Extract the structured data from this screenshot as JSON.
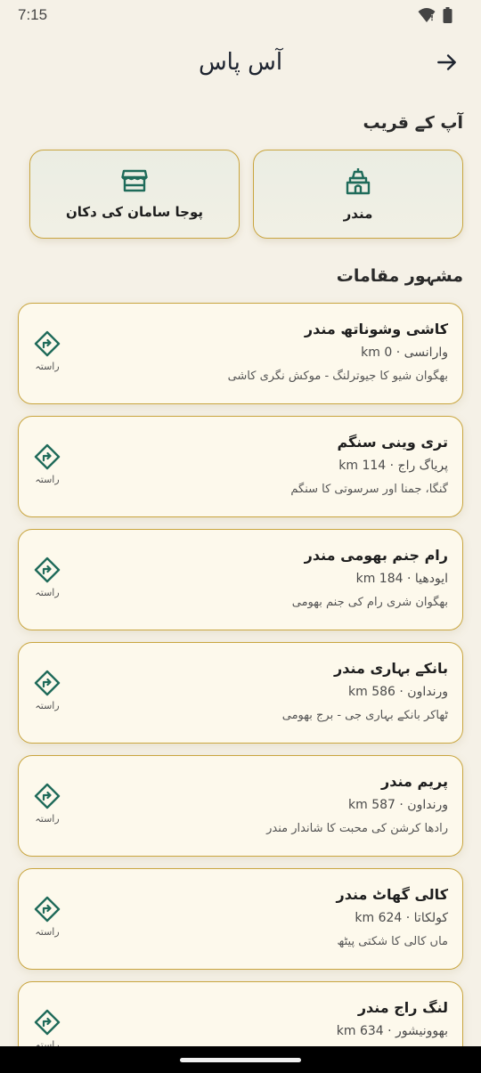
{
  "status_bar": {
    "time": "7:15"
  },
  "app_bar": {
    "title": "آس پاس"
  },
  "nearby": {
    "section_title": "آپ کے قریب",
    "items": [
      {
        "label": "مندر",
        "icon": "temple-icon"
      },
      {
        "label": "پوجا سامان کی دکان",
        "icon": "store-icon"
      }
    ]
  },
  "famous": {
    "section_title": "مشہور مقامات",
    "route_label": "راستہ",
    "places": [
      {
        "name": "کاشی وشوناتھ مندر",
        "meta": "وارانسی · km 0",
        "desc": "بھگوان شیو کا جیوترلنگ - موکش نگری کاشی"
      },
      {
        "name": "تری وینی سنگم",
        "meta": "پریاگ راج · km 114",
        "desc": "گنگا، جمنا اور سرسوتی کا سنگم"
      },
      {
        "name": "رام جنم بھومی مندر",
        "meta": "ایودھیا · km 184",
        "desc": "بھگوان شری رام کی جنم بھومی"
      },
      {
        "name": "بانکے بہاری مندر",
        "meta": "ورنداون · km 586",
        "desc": "ٹھاکر بانکے بہاری جی - برج بھومی"
      },
      {
        "name": "پریم مندر",
        "meta": "ورنداون · km 587",
        "desc": "رادھا کرشن کی محبت کا شاندار مندر"
      },
      {
        "name": "کالی گھاٹ مندر",
        "meta": "کولکاتا · km 624",
        "desc": "ماں کالی کا شکتی پیٹھ"
      },
      {
        "name": "لنگ راج مندر",
        "meta": "بھوونیشور · km 634",
        "desc": ""
      }
    ]
  },
  "colors": {
    "accent": "#1f6b5a",
    "border": "#c9a53f",
    "background": "#f5f1e7"
  }
}
